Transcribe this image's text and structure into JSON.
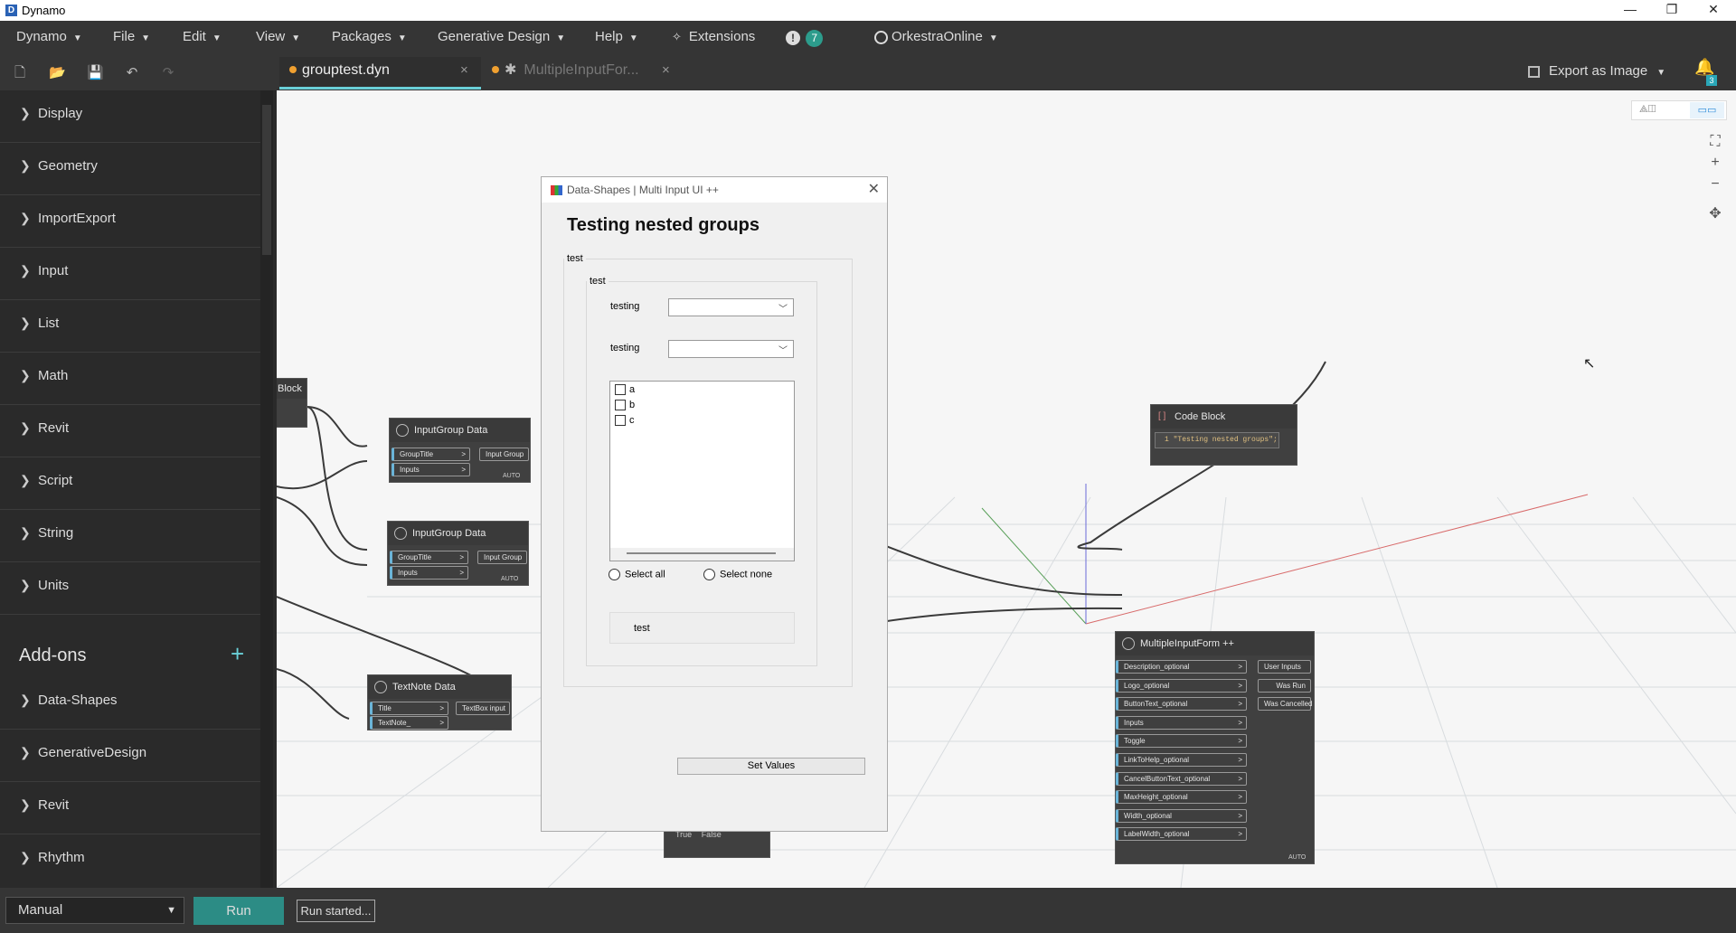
{
  "app": {
    "title": "Dynamo",
    "icon_letter": "D"
  },
  "window": {
    "minimize": "—",
    "restore": "❐",
    "close": "✕"
  },
  "menu": [
    {
      "label": "Dynamo"
    },
    {
      "label": "File"
    },
    {
      "label": "Edit"
    },
    {
      "label": "View"
    },
    {
      "label": "Packages"
    },
    {
      "label": "Generative Design"
    },
    {
      "label": "Help"
    },
    {
      "label": "Extensions"
    },
    {
      "label": "7"
    },
    {
      "label": "OrkestraOnline"
    }
  ],
  "tabs": [
    {
      "label": "grouptest.dyn",
      "state": "active"
    },
    {
      "label": "MultipleInputFor...",
      "state": "inactive"
    }
  ],
  "export": {
    "label": "Export as Image"
  },
  "notifications": {
    "count": "3"
  },
  "library": {
    "categories": [
      "Display",
      "Geometry",
      "ImportExport",
      "Input",
      "List",
      "Math",
      "Revit",
      "Script",
      "String",
      "Units"
    ],
    "addons_title": "Add-ons",
    "addons": [
      "Data-Shapes",
      "GenerativeDesign",
      "Revit",
      "Rhythm"
    ]
  },
  "nodes": {
    "block_partial": {
      "title": "Block"
    },
    "inputgroup1": {
      "title": "InputGroup Data",
      "inputs": [
        "GroupTitle",
        "Inputs"
      ],
      "output": "Input Group",
      "auto": "AUTO"
    },
    "inputgroup2": {
      "title": "InputGroup Data",
      "inputs": [
        "GroupTitle",
        "Inputs"
      ],
      "output": "Input Group",
      "auto": "AUTO"
    },
    "textnote": {
      "title": "TextNote Data",
      "inputs": [
        "Title",
        "TextNote_"
      ],
      "output": "TextBox input"
    },
    "boolean": {
      "true": "True",
      "false": "False"
    },
    "codeblock": {
      "title": "Code Block",
      "code": "1 \"Testing nested groups\";"
    },
    "multiform": {
      "title": "MultipleInputForm ++",
      "inputs": [
        "Description_optional",
        "Logo_optional",
        "ButtonText_optional",
        "Inputs",
        "Toggle",
        "LinkToHelp_optional",
        "CancelButtonText_optional",
        "MaxHeight_optional",
        "Width_optional",
        "LabelWidth_optional"
      ],
      "outputs": [
        "User Inputs",
        "Was Run",
        "Was Cancelled"
      ],
      "auto": "AUTO"
    }
  },
  "dialog": {
    "title": "Data-Shapes | Multi Input UI ++",
    "heading": "Testing nested groups",
    "outer_group": "test",
    "inner_group": "test",
    "fields": [
      {
        "label": "testing",
        "value": ""
      },
      {
        "label": "testing",
        "value": ""
      }
    ],
    "checklist": [
      {
        "label": "a",
        "checked": false
      },
      {
        "label": "b",
        "checked": false
      },
      {
        "label": "c",
        "checked": false
      }
    ],
    "select_all": "Select all",
    "select_none": "Select none",
    "button_test": "test",
    "set_values": "Set Values"
  },
  "status": {
    "run_mode": "Manual",
    "run_label": "Run",
    "run_status": "Run started..."
  },
  "icons": [
    "save-icon",
    "open-icon",
    "new-icon",
    "undo-icon",
    "redo-icon",
    "export-icon",
    "bell-icon",
    "zoom-fit-icon",
    "zoom-in-icon",
    "zoom-out-icon",
    "pan-icon"
  ],
  "colors": {
    "accent": "#6ad0d8",
    "run": "#2c8c85",
    "tab_dot": "#f0a030",
    "chrome": "#353535"
  }
}
